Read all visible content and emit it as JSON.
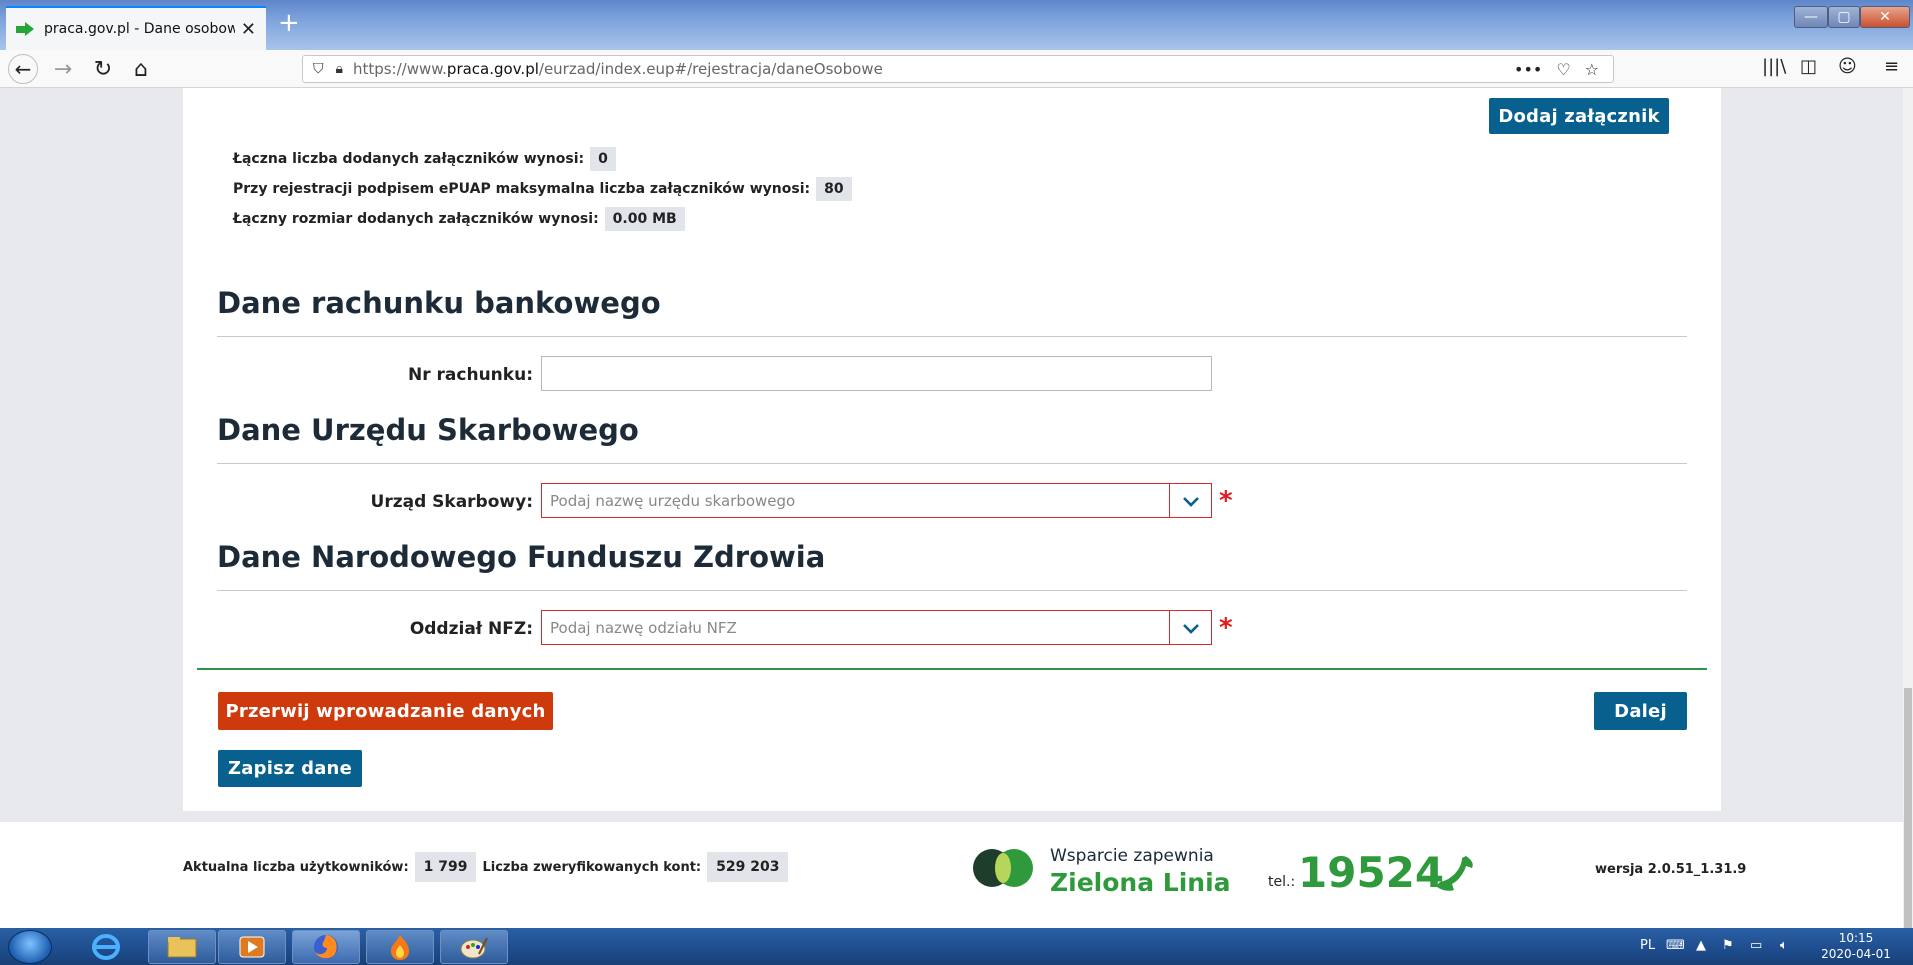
{
  "browser": {
    "tab_title": "praca.gov.pl - Dane osobowe",
    "tab_close": "✕",
    "new_tab": "+",
    "url_prefix": "https://www.",
    "url_domain": "praca.gov.pl",
    "url_path": "/eurzad/index.eup#/rejestracja/daneOsobowe",
    "page_actions": "•••"
  },
  "attachments": {
    "add_button": "Dodaj załącznik",
    "count_label": "Łączna liczba dodanych załączników wynosi:",
    "count_value": "0",
    "max_label": "Przy rejestracji podpisem ePUAP maksymalna liczba załączników wynosi:",
    "max_value": "80",
    "size_label": "Łączny rozmiar dodanych załączników wynosi:",
    "size_value": "0.00 MB"
  },
  "bank": {
    "heading": "Dane rachunku bankowego",
    "account_label": "Nr rachunku:",
    "account_value": ""
  },
  "tax_office": {
    "heading": "Dane Urzędu Skarbowego",
    "label": "Urząd Skarbowy:",
    "placeholder": "Podaj nazwę urzędu skarbowego",
    "required_mark": "*"
  },
  "nfz": {
    "heading": "Dane Narodowego Funduszu Zdrowia",
    "label": "Oddział NFZ:",
    "placeholder": "Podaj nazwę odziału NFZ",
    "required_mark": "*"
  },
  "actions": {
    "abort": "Przerwij wprowadzanie danych",
    "next": "Dalej",
    "save": "Zapisz dane"
  },
  "footer": {
    "users_label": "Aktualna liczba użytkowników:",
    "users_value": "1 799",
    "verified_label": "Liczba zweryfikowanych kont:",
    "verified_value": "529 203",
    "support_line1": "Wsparcie zapewnia",
    "support_line2": "Zielona Linia",
    "tel_label": "tel.:",
    "tel_number": "19524",
    "version": "wersja 2.0.51_1.31.9"
  },
  "taskbar": {
    "language": "PL",
    "time": "10:15",
    "date": "2020-04-01"
  },
  "colors": {
    "primary_blue": "#08608e",
    "abort_red": "#cf3a0c",
    "required_red": "#e01b1b",
    "zielona_green": "#2f9a3b"
  }
}
